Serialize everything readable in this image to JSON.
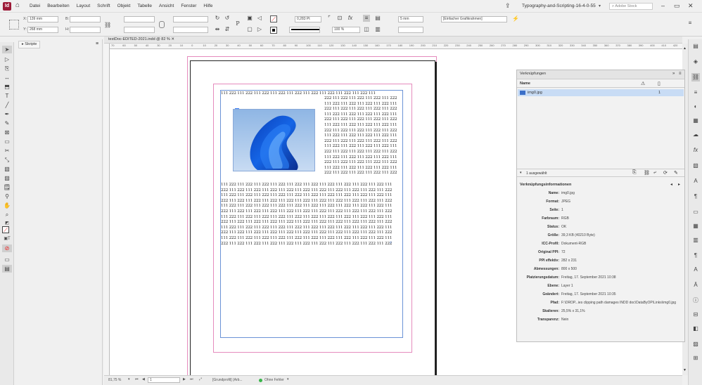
{
  "app": {
    "logo": "Id",
    "title": "Typography-and-Scripting-16-4-0-55"
  },
  "menu": [
    "Datei",
    "Bearbeiten",
    "Layout",
    "Schrift",
    "Objekt",
    "Tabelle",
    "Ansicht",
    "Fenster",
    "Hilfe"
  ],
  "search": {
    "placeholder": "Adobe Stock"
  },
  "control": {
    "x_label": "X:",
    "x_value": "139 mm",
    "y_label": "Y:",
    "y_value": "268 mm",
    "b_label": "B:",
    "h_label": "H:",
    "stroke_weight": "0,283 Pt",
    "scale_percent": "100 %",
    "offset_value": "5 mm",
    "frame_style": "[Einfacher Grafikrahmen]"
  },
  "panels": {
    "scripts_tab": "Skripte"
  },
  "document": {
    "tab_label": "testDoc-EDITED-2021.indd @ 82 %",
    "text_top": [
      "111 222 111 222 111 222 111 222 111 222 111 222 111 222 111 222 111 222 111",
      "222 111 222 111 222 111 222 111 222",
      "111 222 111 222 111 222 111 222 111",
      "222 111 222 111 222 111 222 111 222",
      "111 222 111 222 111 222 111 222 111",
      "222 111 222 111 222 111 222 111 222",
      "111 222 111 222 111 222 111 222 111",
      "222 111 222 111 222 111 222 111 222",
      "111 222 111 222 111 222 111 222 111",
      "222 111 222 111 222 111 222 111 222",
      "111 222 111 222 111 222 111 222 111",
      "222 111 222 111 222 111 222 111 222",
      "111 222 111 222 111 222 111 222 111",
      "222 111 222 111 222 111 222 111 222",
      "111 222 111 222 111 222 111 222 111",
      "222 111 222 111 222 111 222 111 222"
    ],
    "text_bottom": [
      "111 222 111 222 111 222 111 222 111 222 111 222 111 222 111 222 111 222 111 222 111",
      "222 111 222 111 222 111 222 111 222 111 222 111 222 111 222 111 222 111 222 111 222",
      "111 222 111 222 111 222 111 222 111 222 111 222 111 222 111 222 111 222 111 222 111",
      "222 111 222 111 222 111 222 111 222 111 222 111 222 111 222 111 222 111 222 111 222",
      "111 222 111 222 111 222 111 222 111 222 111 222 111 222 111 222 111 222 111 222 111",
      "222 111 222 111 222 111 222 111 222 111 222 111 222 111 222 111 222 111 222 111 222",
      "111 222 111 222 111 222 111 222 111 222 111 222 111 222 111 222 111 222 111 222 111",
      "222 111 222 111 222 111 222 111 222 111 222 111 222 111 222 111 222 111 222 111 222",
      "111 222 111 222 111 222 111 222 111 222 111 222 111 222 111 222 111 222 111 222 111",
      "222 111 222 111 222 111 222 111 222 111 222 111 222 111 222 111 222 111 222 111 222",
      "111 222 111 222 111 222 111 222 111 222 111 222 111 222 111 222 111 222 111 222 111",
      "222 111 222 111 222 111 222 111 222 111 222 111 222 111 222 111 222 111 222 111 222"
    ]
  },
  "ruler_ticks": [
    "70",
    "60",
    "50",
    "40",
    "30",
    "20",
    "10",
    "0",
    "10",
    "20",
    "30",
    "40",
    "50",
    "60",
    "70",
    "80",
    "90",
    "100",
    "110",
    "120",
    "130",
    "140",
    "150",
    "160",
    "170",
    "180",
    "190",
    "200",
    "210",
    "220",
    "230",
    "240",
    "250",
    "260",
    "270",
    "280",
    "290",
    "300",
    "310",
    "320",
    "330",
    "340",
    "350",
    "360",
    "370",
    "380",
    "390",
    "400",
    "410",
    "420"
  ],
  "status": {
    "zoom": "81,75 %",
    "page": "1",
    "profile": "[Grundprofil] (Arb...",
    "preflight": "Ohne Fehler"
  },
  "links_panel": {
    "tab": "Verknüpfungen",
    "col_name": "Name",
    "item": "img0.jpg",
    "item_page": "1",
    "selected": "1 ausgewählt",
    "info_title": "Verknüpfungsinformationen",
    "info": [
      {
        "k": "Name:",
        "v": "img0.jpg"
      },
      {
        "k": "Format:",
        "v": "JPEG"
      },
      {
        "k": "Seite:",
        "v": "1"
      },
      {
        "k": "Farbraum:",
        "v": "RGB"
      },
      {
        "k": "Status:",
        "v": "OK"
      },
      {
        "k": "Größe:",
        "v": "39,3 KB (40210 Byte)"
      },
      {
        "k": "ICC-Profil:",
        "v": "Dokument-RGB"
      },
      {
        "k": "Original PPI:",
        "v": "72"
      },
      {
        "k": "PPI effektiv:",
        "v": "282 x 231"
      },
      {
        "k": "Abmessungen:",
        "v": "800 x 500"
      },
      {
        "k": "Platzierungsdatum:",
        "v": "Freitag, 17. September 2021 10:38"
      },
      {
        "k": "Ebene:",
        "v": "Layer 1"
      },
      {
        "k": "Geändert:",
        "v": "Freitag, 17. September 2021 10:35"
      },
      {
        "k": "Pfad:",
        "v": "F:\\DROP...ies clipping path damages INDD doc\\DataByOP\\Links\\img0.jpg"
      },
      {
        "k": "Skalieren:",
        "v": "25,5% x 31,1%"
      },
      {
        "k": "Transparenz:",
        "v": "Nein"
      }
    ]
  },
  "colors": {
    "accent_blue": "#3d7ef5",
    "margin_magenta": "#e58bbd",
    "frame_blue": "#6b93d6",
    "logo": "#9c1b38",
    "selection": "#c8dcf5",
    "preflight_ok": "#39b54a"
  }
}
